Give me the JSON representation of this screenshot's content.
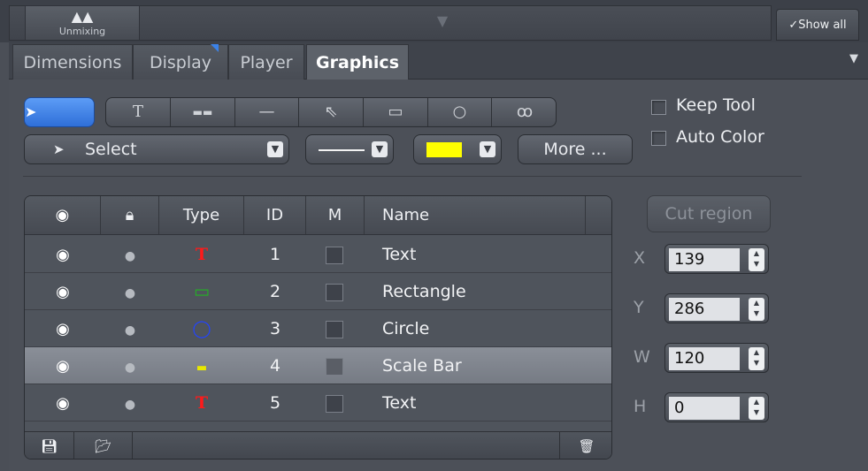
{
  "top": {
    "unmixing_label": "Unmixing",
    "show_all": "✓Show all"
  },
  "tabs": [
    {
      "label": "Dimensions"
    },
    {
      "label": "Display"
    },
    {
      "label": "Player"
    },
    {
      "label": "Graphics",
      "active": true
    }
  ],
  "tools": {
    "pointer_icon": "pointer-icon",
    "items": [
      "text-tool",
      "scale-bar-tool",
      "line-tool",
      "arrow-tool",
      "rectangle-tool",
      "circle-tool",
      "freehand-tool"
    ],
    "glyphs": [
      "T",
      "▬",
      "—",
      "⇖",
      "▭",
      "○",
      "ꝏ"
    ]
  },
  "mode_select": {
    "label": "Select"
  },
  "line_style": {
    "value": "solid"
  },
  "color": {
    "value": "#ffff00"
  },
  "more_label": "More ...",
  "options": {
    "keep_tool": "Keep Tool",
    "auto_color": "Auto Color"
  },
  "table": {
    "headers": [
      "",
      "",
      "Type",
      "ID",
      "M",
      "Name"
    ],
    "rows": [
      {
        "type_icon": "text-type-icon",
        "type_glyph": "T",
        "type_color": "#ff1a1a",
        "id": "1",
        "name": "Text",
        "selected": false
      },
      {
        "type_icon": "rectangle-type-icon",
        "type_glyph": "▭",
        "type_color": "#22b422",
        "id": "2",
        "name": "Rectangle",
        "selected": false
      },
      {
        "type_icon": "circle-type-icon",
        "type_glyph": "◯",
        "type_color": "#2244ff",
        "id": "3",
        "name": "Circle",
        "selected": false
      },
      {
        "type_icon": "scale-bar-type-icon",
        "type_glyph": "▬",
        "type_color": "#e8e800",
        "id": "4",
        "name": "Scale Bar",
        "selected": true
      },
      {
        "type_icon": "text-type-icon",
        "type_glyph": "T",
        "type_color": "#ff1a1a",
        "id": "5",
        "name": "Text",
        "selected": false
      }
    ]
  },
  "cut_region": "Cut region",
  "coords": [
    {
      "label": "X",
      "value": "139"
    },
    {
      "label": "Y",
      "value": "286"
    },
    {
      "label": "W",
      "value": "120"
    },
    {
      "label": "H",
      "value": "0"
    }
  ]
}
